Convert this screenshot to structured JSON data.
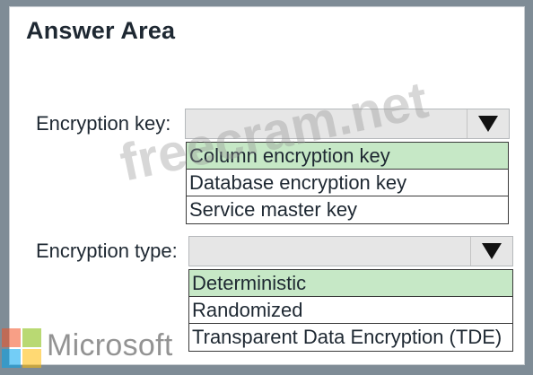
{
  "answer_area": {
    "title": "Answer Area"
  },
  "encryption_key": {
    "label": "Encryption key:",
    "options": [
      "Column encryption key",
      "Database encryption key",
      "Service master key"
    ],
    "highlighted_option": "Column encryption key"
  },
  "encryption_type": {
    "label": "Encryption type:",
    "options": [
      "Deterministic",
      "Randomized",
      "Transparent Data Encryption (TDE)"
    ],
    "highlighted_option": "Deterministic"
  },
  "watermark": {
    "text": "freecram.net"
  },
  "branding": {
    "text": "Microsoft",
    "logo_colors": [
      "#f25022",
      "#7fba00",
      "#00a4ef",
      "#ffb900"
    ]
  },
  "colors": {
    "highlight": "#c6e8c6",
    "select_background": "#e6e6e6",
    "frame_background": "#7f8c96"
  }
}
